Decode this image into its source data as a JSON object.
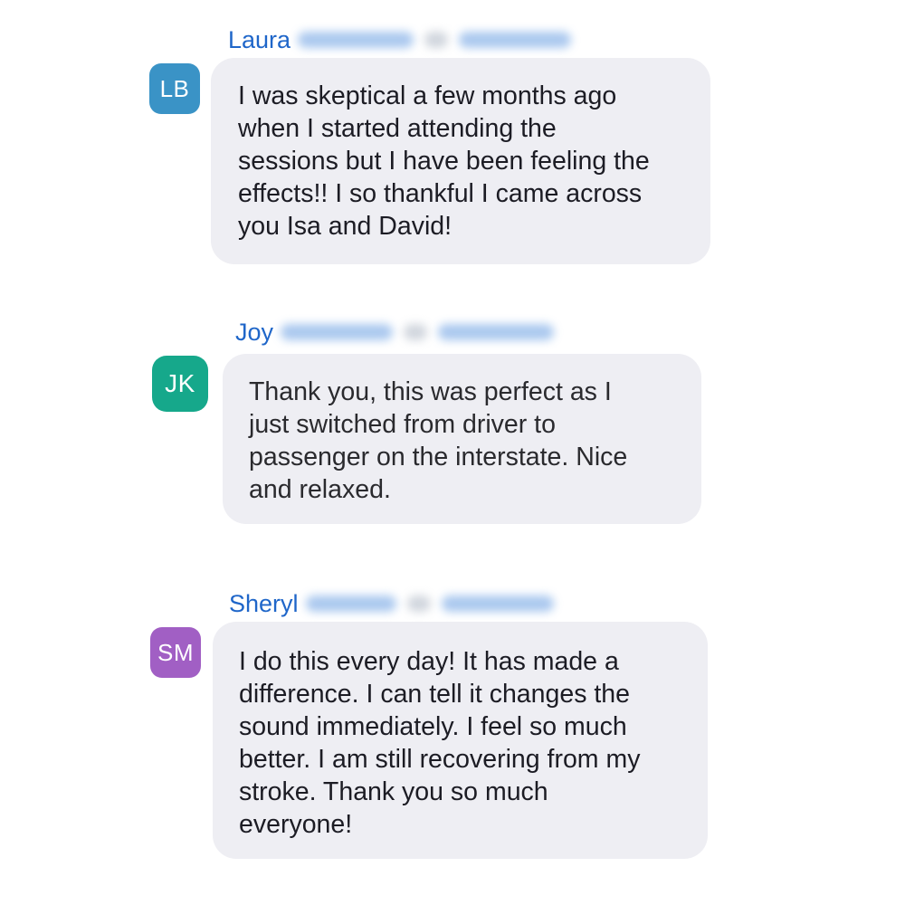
{
  "chat": {
    "messages": [
      {
        "first_name": "Laura",
        "avatar_initials": "LB",
        "avatar_color": "#3a93c6",
        "text": "I was skeptical a few months ago\nwhen I started attending the\nsessions but I have been feeling the\neffects!! I so thankful I came across\nyou Isa and David!"
      },
      {
        "first_name": "Joy",
        "avatar_initials": "JK",
        "avatar_color": "#16a88b",
        "text": "Thank you, this was perfect as I\njust switched from driver to\npassenger on the interstate. Nice\nand relaxed."
      },
      {
        "first_name": "Sheryl",
        "avatar_initials": "SM",
        "avatar_color": "#a15fc4",
        "text": "I do this every day! It has made a\ndifference. I can tell it changes the\nsound immediately. I feel so much\nbetter. I am still recovering from my\nstroke. Thank you so much\neveryone!"
      }
    ]
  }
}
